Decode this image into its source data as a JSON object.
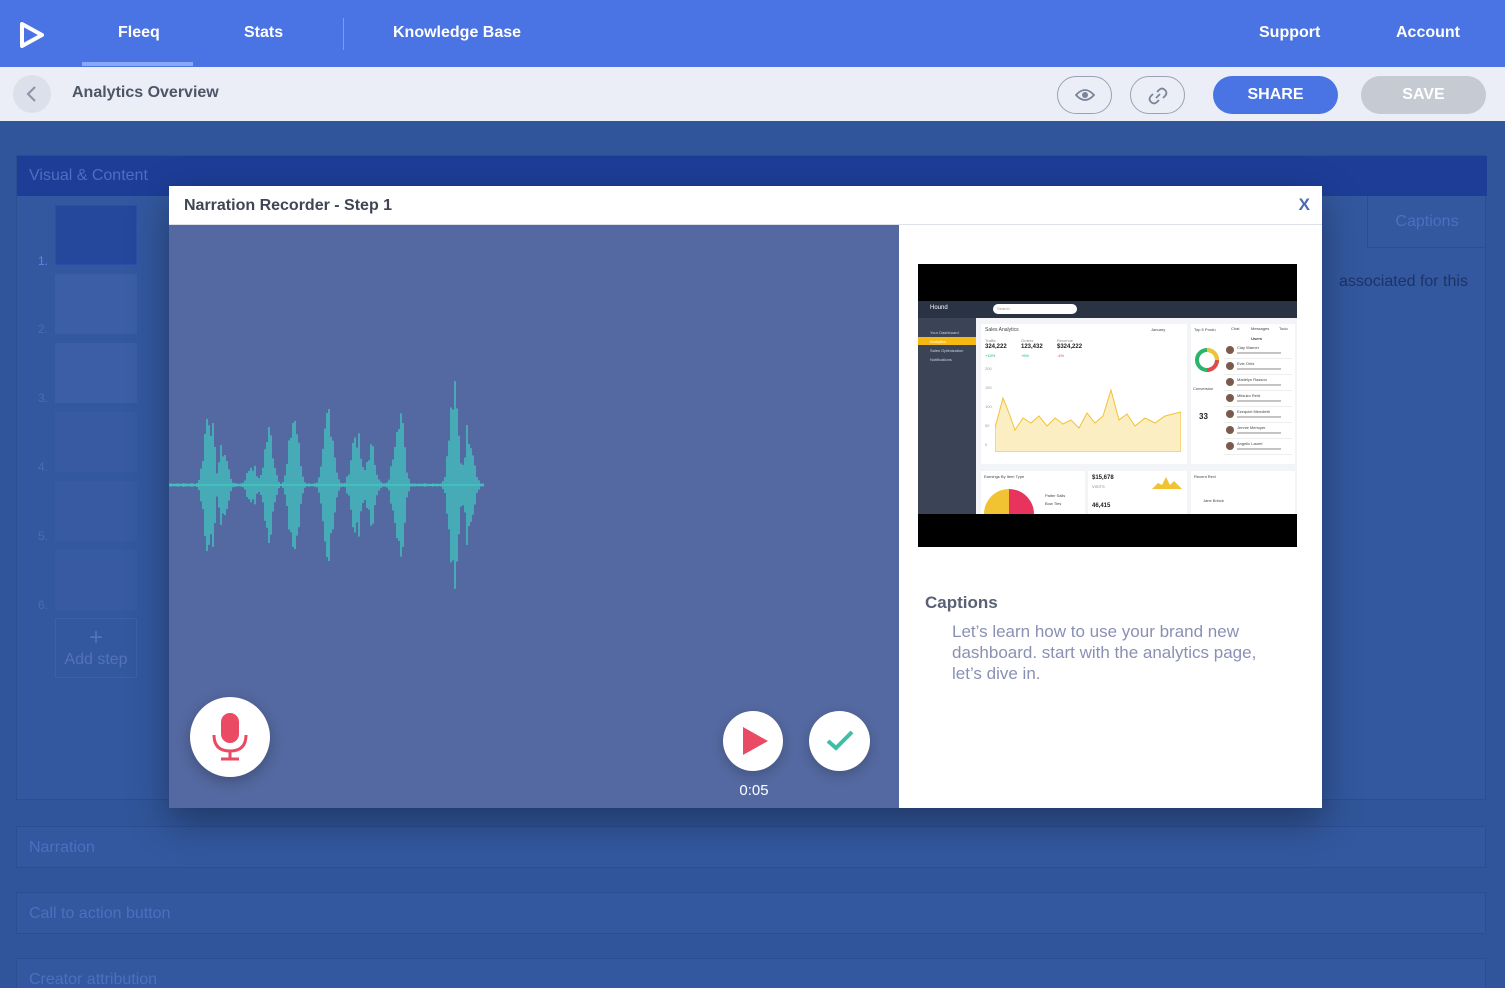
{
  "nav": {
    "items": [
      {
        "label": "Fleeq",
        "active": true
      },
      {
        "label": "Stats"
      },
      {
        "label": "Knowledge Base"
      },
      {
        "label": "Support"
      },
      {
        "label": "Account"
      }
    ],
    "logo_icon": "play-arrow-logo-icon"
  },
  "toolbar": {
    "title": "Analytics Overview",
    "back_icon": "chevron-left-icon",
    "preview_icon": "eye-icon",
    "link_icon": "link-icon",
    "share_label": "SHARE",
    "save_label": "SAVE"
  },
  "background": {
    "panel_title": "Visual & Content",
    "captions_tab": "Captions",
    "side_text": "associated for this",
    "steps": [
      "1.",
      "2.",
      "3.",
      "4.",
      "5.",
      "6."
    ],
    "add_step_plus": "+",
    "add_step_label": "Add step",
    "sections": [
      "Narration",
      "Call to action button",
      "Creator attribution"
    ]
  },
  "modal": {
    "title": "Narration Recorder - Step 1",
    "close_label": "X",
    "timer": "0:05",
    "waveform_color": "#3ed6c6",
    "mic_color": "#ea4a63",
    "play_color": "#ea4a63",
    "check_color": "#3dbfa7",
    "captions_title": "Captions",
    "captions_text": "Let’s learn how to use your brand new dashboard. start with the analytics page, let’s dive in.",
    "preview": {
      "brand": "Hound",
      "search_placeholder": "Search",
      "menu": [
        "Your Dashboard",
        "Analytics",
        "Sales Optimization",
        "Notifications"
      ],
      "card_title": "Sales Analytics",
      "card_filter": "January",
      "metrics": [
        {
          "label": "Traffic",
          "value": "324,222",
          "delta": "+15%"
        },
        {
          "label": "Orders",
          "value": "123,432",
          "delta": "+6%"
        },
        {
          "label": "Revenue",
          "value": "$324,222",
          "delta": "-4%"
        }
      ],
      "y_ticks": [
        "200",
        "150",
        "100",
        "50",
        "0"
      ],
      "panel_top": "Top 5 Produ",
      "panel_conversion": "Conversion",
      "conversion_value": "33",
      "users_title": "Users",
      "tabs": [
        "Chat",
        "Messages",
        "Todo"
      ],
      "users": [
        "Clay Warner",
        "Evie Ortiz",
        "Madelyn Rasson",
        "Mitsuko Reid",
        "Ezequiel Mendietti",
        "Jennie Mehuyer",
        "Angelic Laurel",
        "Priscilla Sky",
        "Linda Stock"
      ],
      "earnings_title": "Earnings By Item Type",
      "earnings_legend": [
        "Paiter Sails",
        "Bow Ties"
      ],
      "visits_value": "$15,678",
      "visits_label": "VISITS",
      "second_value": "46,415",
      "recent_title": "Recent Revi",
      "reviewer": "Jane Brinck"
    }
  }
}
